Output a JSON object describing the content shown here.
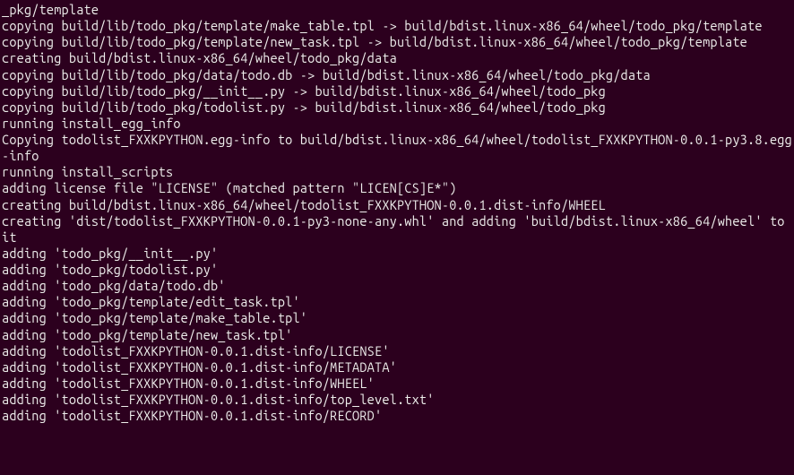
{
  "terminal": {
    "lines": [
      "_pkg/template",
      "copying build/lib/todo_pkg/template/make_table.tpl -> build/bdist.linux-x86_64/wheel/todo_pkg/template",
      "copying build/lib/todo_pkg/template/new_task.tpl -> build/bdist.linux-x86_64/wheel/todo_pkg/template",
      "creating build/bdist.linux-x86_64/wheel/todo_pkg/data",
      "copying build/lib/todo_pkg/data/todo.db -> build/bdist.linux-x86_64/wheel/todo_pkg/data",
      "copying build/lib/todo_pkg/__init__.py -> build/bdist.linux-x86_64/wheel/todo_pkg",
      "copying build/lib/todo_pkg/todolist.py -> build/bdist.linux-x86_64/wheel/todo_pkg",
      "running install_egg_info",
      "Copying todolist_FXXKPYTHON.egg-info to build/bdist.linux-x86_64/wheel/todolist_FXXKPYTHON-0.0.1-py3.8.egg-info",
      "running install_scripts",
      "adding license file \"LICENSE\" (matched pattern \"LICEN[CS]E*\")",
      "creating build/bdist.linux-x86_64/wheel/todolist_FXXKPYTHON-0.0.1.dist-info/WHEEL",
      "creating 'dist/todolist_FXXKPYTHON-0.0.1-py3-none-any.whl' and adding 'build/bdist.linux-x86_64/wheel' to it",
      "adding 'todo_pkg/__init__.py'",
      "adding 'todo_pkg/todolist.py'",
      "adding 'todo_pkg/data/todo.db'",
      "adding 'todo_pkg/template/edit_task.tpl'",
      "adding 'todo_pkg/template/make_table.tpl'",
      "adding 'todo_pkg/template/new_task.tpl'",
      "adding 'todolist_FXXKPYTHON-0.0.1.dist-info/LICENSE'",
      "adding 'todolist_FXXKPYTHON-0.0.1.dist-info/METADATA'",
      "adding 'todolist_FXXKPYTHON-0.0.1.dist-info/WHEEL'",
      "adding 'todolist_FXXKPYTHON-0.0.1.dist-info/top_level.txt'",
      "adding 'todolist_FXXKPYTHON-0.0.1.dist-info/RECORD'"
    ]
  }
}
